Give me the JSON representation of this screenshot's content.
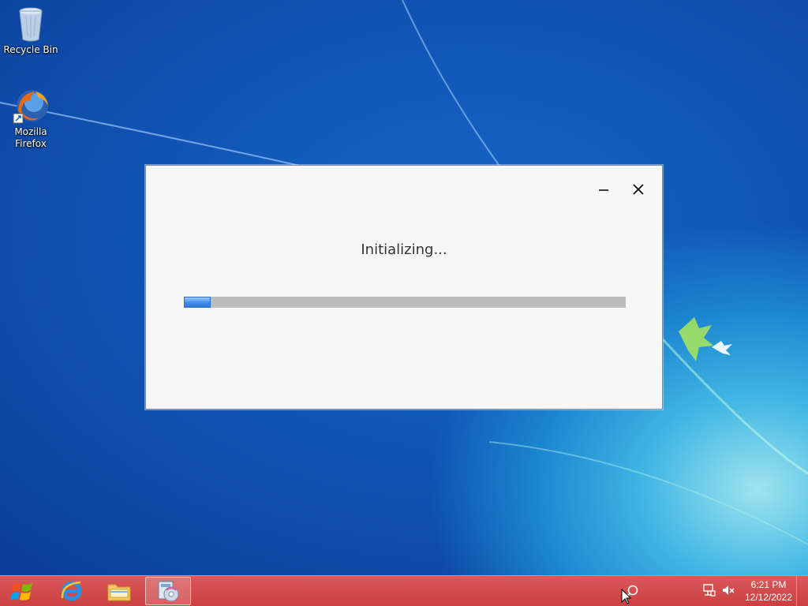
{
  "desktop": {
    "icons": [
      {
        "label": "Recycle Bin",
        "icon": "recycle-bin-icon"
      },
      {
        "label_line1": "Mozilla",
        "label_line2": "Firefox",
        "icon": "firefox-icon"
      }
    ]
  },
  "dialog": {
    "status_text": "Initializing...",
    "progress_fraction": 0.06,
    "minimize_icon": "minimize-icon",
    "close_icon": "close-icon"
  },
  "taskbar": {
    "start_icon": "windows-start-icon",
    "pinned": [
      {
        "icon": "internet-explorer-icon"
      },
      {
        "icon": "file-explorer-icon"
      },
      {
        "icon": "installer-disc-icon",
        "active": true
      }
    ],
    "tray": {
      "icons": [
        "network-icon",
        "volume-muted-icon"
      ],
      "time": "6:21 PM",
      "date": "12/12/2022"
    }
  },
  "colors": {
    "taskbar": "#cc3f40",
    "progress_fill": "#3f8ee8",
    "progress_track": "#bcbcbc",
    "dialog_bg": "#f7f7f7"
  }
}
